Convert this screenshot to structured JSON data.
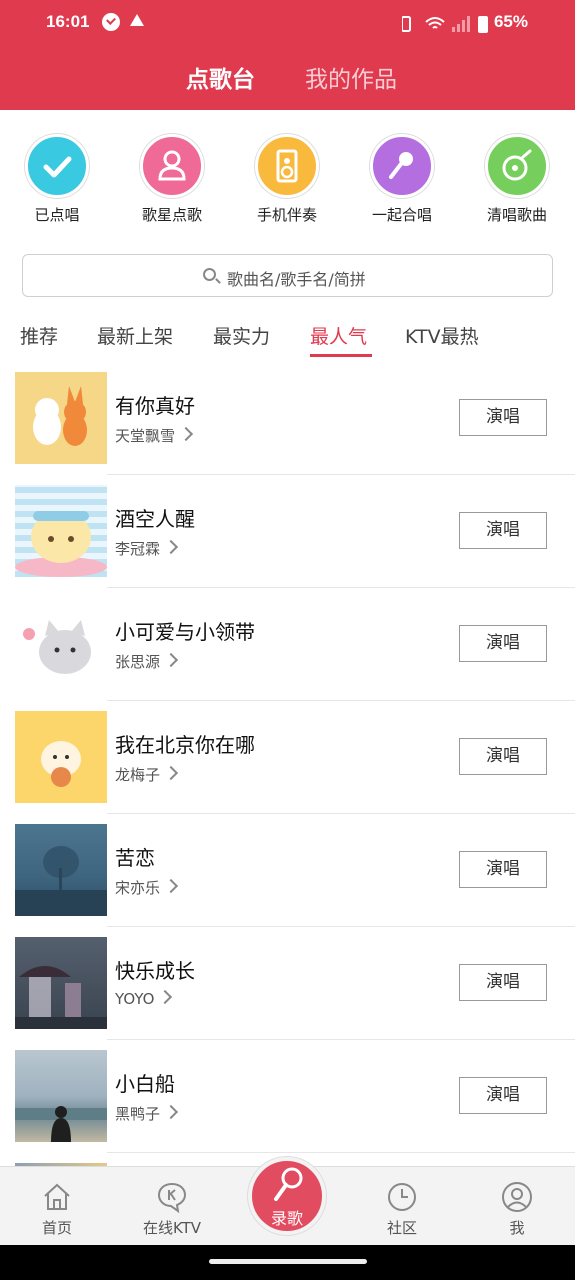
{
  "status_bar": {
    "time": "16:01",
    "battery": "65%"
  },
  "header": {
    "tab_active": "点歌台",
    "tab_inactive": "我的作品"
  },
  "shortcuts": [
    {
      "label": "已点唱",
      "icon": "checkmark-icon",
      "color": "#39c9e0"
    },
    {
      "label": "歌星点歌",
      "icon": "singer-icon",
      "color": "#f06a98"
    },
    {
      "label": "手机伴奏",
      "icon": "speaker-icon",
      "color": "#f9b93c"
    },
    {
      "label": "一起合唱",
      "icon": "microphone-icon",
      "color": "#b46ee0"
    },
    {
      "label": "清唱歌曲",
      "icon": "record-disc-icon",
      "color": "#76cf5c"
    }
  ],
  "search": {
    "placeholder": "歌曲名/歌手名/简拼"
  },
  "categories": [
    "推荐",
    "最新上架",
    "最实力",
    "最人气",
    "KTV最热"
  ],
  "active_category": "最人气",
  "songs": [
    {
      "title": "有你真好",
      "artist": "天堂飘雪",
      "button": "演唱"
    },
    {
      "title": "酒空人醒",
      "artist": "李冠霖",
      "button": "演唱"
    },
    {
      "title": "小可爱与小领带",
      "artist": "张思源",
      "button": "演唱"
    },
    {
      "title": "我在北京你在哪",
      "artist": "龙梅子",
      "button": "演唱"
    },
    {
      "title": "苦恋",
      "artist": "宋亦乐",
      "button": "演唱"
    },
    {
      "title": "快乐成长",
      "artist": "YOYO",
      "button": "演唱"
    },
    {
      "title": "小白船",
      "artist": "黑鸭子",
      "button": "演唱"
    }
  ],
  "bottom_nav": {
    "home": "首页",
    "ktv": "在线KTV",
    "record": "录歌",
    "community": "社区",
    "me": "我"
  },
  "colors": {
    "brand": "#e03a4f"
  }
}
